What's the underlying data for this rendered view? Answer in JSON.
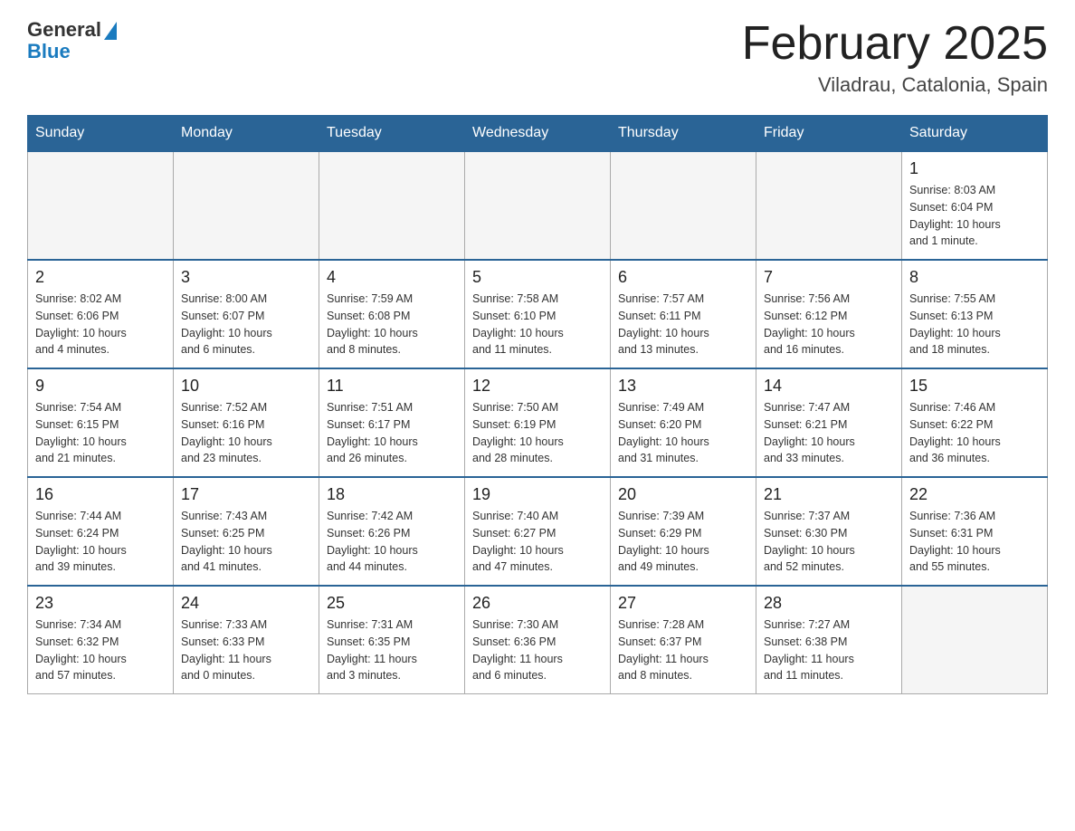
{
  "header": {
    "logo_general": "General",
    "logo_blue": "Blue",
    "title": "February 2025",
    "location": "Viladrau, Catalonia, Spain"
  },
  "days_of_week": [
    "Sunday",
    "Monday",
    "Tuesday",
    "Wednesday",
    "Thursday",
    "Friday",
    "Saturday"
  ],
  "weeks": [
    [
      {
        "day": "",
        "info": ""
      },
      {
        "day": "",
        "info": ""
      },
      {
        "day": "",
        "info": ""
      },
      {
        "day": "",
        "info": ""
      },
      {
        "day": "",
        "info": ""
      },
      {
        "day": "",
        "info": ""
      },
      {
        "day": "1",
        "info": "Sunrise: 8:03 AM\nSunset: 6:04 PM\nDaylight: 10 hours\nand 1 minute."
      }
    ],
    [
      {
        "day": "2",
        "info": "Sunrise: 8:02 AM\nSunset: 6:06 PM\nDaylight: 10 hours\nand 4 minutes."
      },
      {
        "day": "3",
        "info": "Sunrise: 8:00 AM\nSunset: 6:07 PM\nDaylight: 10 hours\nand 6 minutes."
      },
      {
        "day": "4",
        "info": "Sunrise: 7:59 AM\nSunset: 6:08 PM\nDaylight: 10 hours\nand 8 minutes."
      },
      {
        "day": "5",
        "info": "Sunrise: 7:58 AM\nSunset: 6:10 PM\nDaylight: 10 hours\nand 11 minutes."
      },
      {
        "day": "6",
        "info": "Sunrise: 7:57 AM\nSunset: 6:11 PM\nDaylight: 10 hours\nand 13 minutes."
      },
      {
        "day": "7",
        "info": "Sunrise: 7:56 AM\nSunset: 6:12 PM\nDaylight: 10 hours\nand 16 minutes."
      },
      {
        "day": "8",
        "info": "Sunrise: 7:55 AM\nSunset: 6:13 PM\nDaylight: 10 hours\nand 18 minutes."
      }
    ],
    [
      {
        "day": "9",
        "info": "Sunrise: 7:54 AM\nSunset: 6:15 PM\nDaylight: 10 hours\nand 21 minutes."
      },
      {
        "day": "10",
        "info": "Sunrise: 7:52 AM\nSunset: 6:16 PM\nDaylight: 10 hours\nand 23 minutes."
      },
      {
        "day": "11",
        "info": "Sunrise: 7:51 AM\nSunset: 6:17 PM\nDaylight: 10 hours\nand 26 minutes."
      },
      {
        "day": "12",
        "info": "Sunrise: 7:50 AM\nSunset: 6:19 PM\nDaylight: 10 hours\nand 28 minutes."
      },
      {
        "day": "13",
        "info": "Sunrise: 7:49 AM\nSunset: 6:20 PM\nDaylight: 10 hours\nand 31 minutes."
      },
      {
        "day": "14",
        "info": "Sunrise: 7:47 AM\nSunset: 6:21 PM\nDaylight: 10 hours\nand 33 minutes."
      },
      {
        "day": "15",
        "info": "Sunrise: 7:46 AM\nSunset: 6:22 PM\nDaylight: 10 hours\nand 36 minutes."
      }
    ],
    [
      {
        "day": "16",
        "info": "Sunrise: 7:44 AM\nSunset: 6:24 PM\nDaylight: 10 hours\nand 39 minutes."
      },
      {
        "day": "17",
        "info": "Sunrise: 7:43 AM\nSunset: 6:25 PM\nDaylight: 10 hours\nand 41 minutes."
      },
      {
        "day": "18",
        "info": "Sunrise: 7:42 AM\nSunset: 6:26 PM\nDaylight: 10 hours\nand 44 minutes."
      },
      {
        "day": "19",
        "info": "Sunrise: 7:40 AM\nSunset: 6:27 PM\nDaylight: 10 hours\nand 47 minutes."
      },
      {
        "day": "20",
        "info": "Sunrise: 7:39 AM\nSunset: 6:29 PM\nDaylight: 10 hours\nand 49 minutes."
      },
      {
        "day": "21",
        "info": "Sunrise: 7:37 AM\nSunset: 6:30 PM\nDaylight: 10 hours\nand 52 minutes."
      },
      {
        "day": "22",
        "info": "Sunrise: 7:36 AM\nSunset: 6:31 PM\nDaylight: 10 hours\nand 55 minutes."
      }
    ],
    [
      {
        "day": "23",
        "info": "Sunrise: 7:34 AM\nSunset: 6:32 PM\nDaylight: 10 hours\nand 57 minutes."
      },
      {
        "day": "24",
        "info": "Sunrise: 7:33 AM\nSunset: 6:33 PM\nDaylight: 11 hours\nand 0 minutes."
      },
      {
        "day": "25",
        "info": "Sunrise: 7:31 AM\nSunset: 6:35 PM\nDaylight: 11 hours\nand 3 minutes."
      },
      {
        "day": "26",
        "info": "Sunrise: 7:30 AM\nSunset: 6:36 PM\nDaylight: 11 hours\nand 6 minutes."
      },
      {
        "day": "27",
        "info": "Sunrise: 7:28 AM\nSunset: 6:37 PM\nDaylight: 11 hours\nand 8 minutes."
      },
      {
        "day": "28",
        "info": "Sunrise: 7:27 AM\nSunset: 6:38 PM\nDaylight: 11 hours\nand 11 minutes."
      },
      {
        "day": "",
        "info": ""
      }
    ]
  ]
}
